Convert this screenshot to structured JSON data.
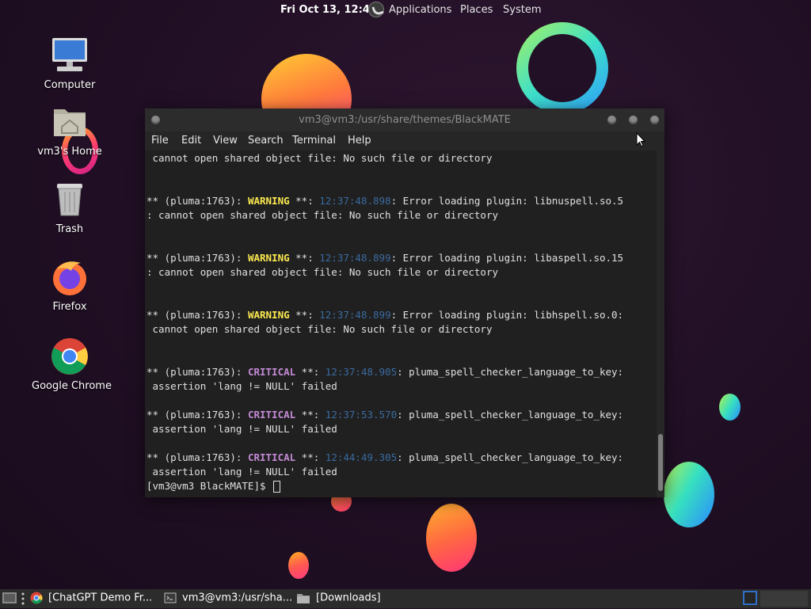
{
  "top_panel": {
    "clock": "Fri Oct 13, 12:47",
    "menus": [
      "Applications",
      "Places",
      "System"
    ]
  },
  "desktop_icons": [
    {
      "label": "Computer",
      "icon": "computer-icon"
    },
    {
      "label": "vm3's Home",
      "icon": "home-folder-icon"
    },
    {
      "label": "Trash",
      "icon": "trash-icon"
    },
    {
      "label": "Firefox",
      "icon": "firefox-icon"
    },
    {
      "label": "Google Chrome",
      "icon": "chrome-icon"
    }
  ],
  "terminal": {
    "title": "vm3@vm3:/usr/share/themes/BlackMATE",
    "menu": [
      "File",
      "Edit",
      "View",
      "Search",
      "Terminal",
      "Help"
    ],
    "lines": {
      "l0": " cannot open shared object file: No such file or directory",
      "w1": {
        "pre": "** (pluma:1763): ",
        "level": "WARNING",
        "mid": " **: ",
        "ts": "12:37:48.898",
        "msg": ": Error loading plugin: libnuspell.so.5"
      },
      "w1b": ": cannot open shared object file: No such file or directory",
      "w2": {
        "pre": "** (pluma:1763): ",
        "level": "WARNING",
        "mid": " **: ",
        "ts": "12:37:48.899",
        "msg": ": Error loading plugin: libaspell.so.15"
      },
      "w2b": ": cannot open shared object file: No such file or directory",
      "w3": {
        "pre": "** (pluma:1763): ",
        "level": "WARNING",
        "mid": " **: ",
        "ts": "12:37:48.899",
        "msg": ": Error loading plugin: libhspell.so.0:"
      },
      "w3b": " cannot open shared object file: No such file or directory",
      "c1": {
        "pre": "** (pluma:1763): ",
        "level": "CRITICAL",
        "mid": " **: ",
        "ts": "12:37:48.905",
        "msg": ": pluma_spell_checker_language_to_key:"
      },
      "c1b": " assertion 'lang != NULL' failed",
      "c2": {
        "pre": "** (pluma:1763): ",
        "level": "CRITICAL",
        "mid": " **: ",
        "ts": "12:37:53.570",
        "msg": ": pluma_spell_checker_language_to_key:"
      },
      "c2b": " assertion 'lang != NULL' failed",
      "c3": {
        "pre": "** (pluma:1763): ",
        "level": "CRITICAL",
        "mid": " **: ",
        "ts": "12:44:49.305",
        "msg": ": pluma_spell_checker_language_to_key:"
      },
      "c3b": " assertion 'lang != NULL' failed",
      "prompt": "[vm3@vm3 BlackMATE]$ "
    }
  },
  "taskbar": {
    "tasks": [
      {
        "label": "[ChatGPT Demo Fr...",
        "icon": "chrome-icon"
      },
      {
        "label": "vm3@vm3:/usr/sha...",
        "icon": "terminal-icon"
      },
      {
        "label": "[Downloads]",
        "icon": "folder-icon"
      }
    ]
  },
  "colors": {
    "warning": "#fce94f",
    "critical": "#c48ad6",
    "timestamp": "#3a6aa0",
    "terminal_bg": "#202020"
  }
}
